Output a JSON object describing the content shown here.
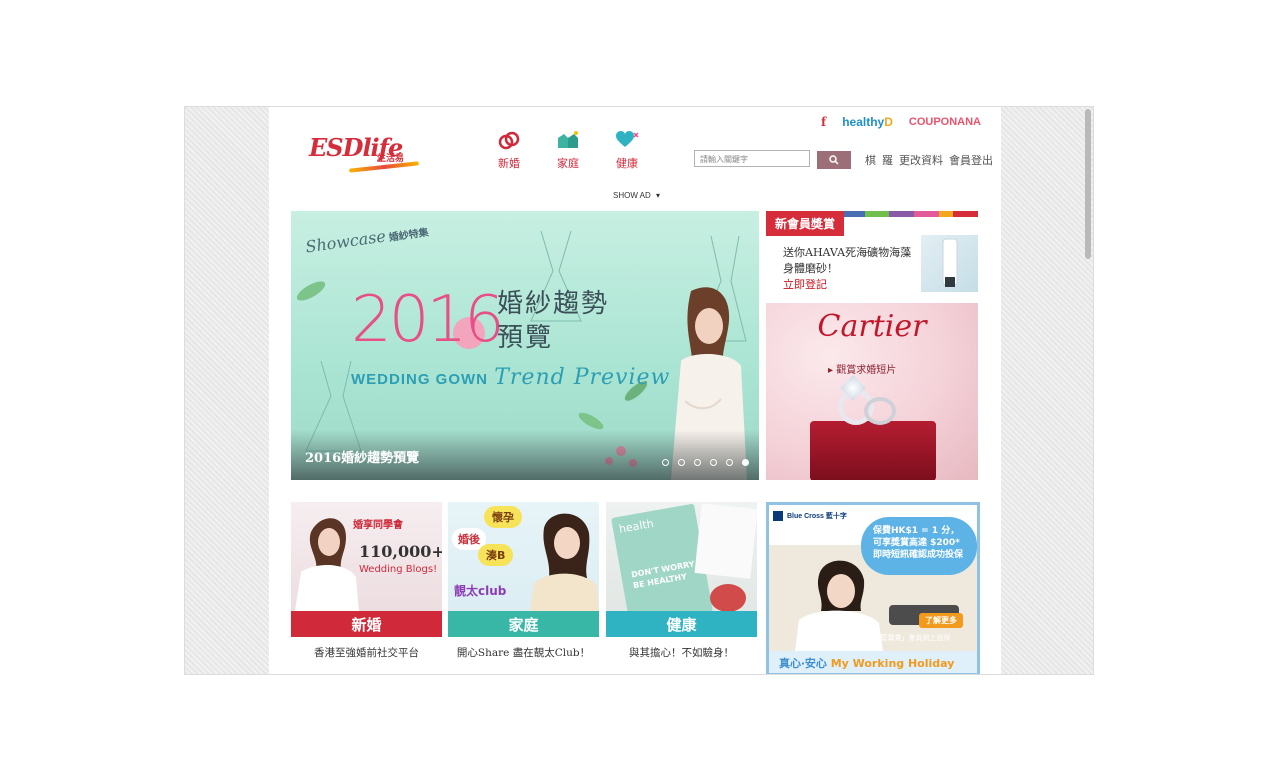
{
  "brand": {
    "logo_text": "ESDlife",
    "logo_sub": "生活易"
  },
  "nav": [
    {
      "label": "新婚",
      "icon": "rings-icon"
    },
    {
      "label": "家庭",
      "icon": "family-icon"
    },
    {
      "label": "健康",
      "icon": "heart-icon"
    }
  ],
  "toplinks": {
    "facebook": "f",
    "healthyd_a": "healthy",
    "healthyd_b": "D",
    "couponana": "COUPONANA"
  },
  "search": {
    "placeholder": "請輸入關鍵字"
  },
  "userlinks": [
    "棋",
    "羅",
    "更改資料",
    "會員登出"
  ],
  "showad": "SHOW AD",
  "hero": {
    "showcase": "Showcase",
    "showcase_tag": "婚紗特集",
    "year": "2016",
    "title_cn_1": "婚紗趨勢",
    "title_cn_2": "預覽",
    "title_en_a": "WEDDING GOWN",
    "title_en_b": "Trend Preview",
    "caption": "2016婚紗趨勢預覽",
    "dots": 6,
    "active_dot": 6
  },
  "member": {
    "tag": "新會員獎賞",
    "text": "送你AHAVA死海礦物海藻身體磨砂！",
    "link": "立即登記",
    "bar_colors": [
      "#d62d3a",
      "#4a6cb3",
      "#6fbf4a",
      "#8b5aa6",
      "#e35b9b",
      "#f1a81c",
      "#d62d3a"
    ]
  },
  "cartier": {
    "logo": "Cartier",
    "cta": "▸ 觀賞求婚短片"
  },
  "tiles": [
    {
      "label": "新婚",
      "desc": "香港至強婚前社交平台",
      "bar": "#d0293a",
      "img_text": "110,000+",
      "img_sub": "Wedding Blogs!",
      "img_tag": "婚享同學會"
    },
    {
      "label": "家庭",
      "desc": "開心Share 盡在靚太Club！",
      "bar": "#38b6a6",
      "img_text": "懷孕",
      "img_sub": "婚後",
      "img_tag": "湊B",
      "img_club": "靚太club"
    },
    {
      "label": "健康",
      "desc": "與其擔心！不如驗身！",
      "bar": "#2fb3c2",
      "img_text": "DON'T WORRY",
      "img_sub": "BE HEALTHY",
      "img_tag": "health"
    }
  ],
  "bluecross": {
    "brand": "Blue Cross 藍十字",
    "line1": "保費HK$1 = 1 分，",
    "line2": "可享獎賞高達 $200*",
    "line3": "即時短訊確認成功投保",
    "more": "了解更多",
    "note": "*適用於「藍寶賞」會員網上投保",
    "foot_a": "真心‧安心",
    "foot_b": "My Working Holiday"
  }
}
